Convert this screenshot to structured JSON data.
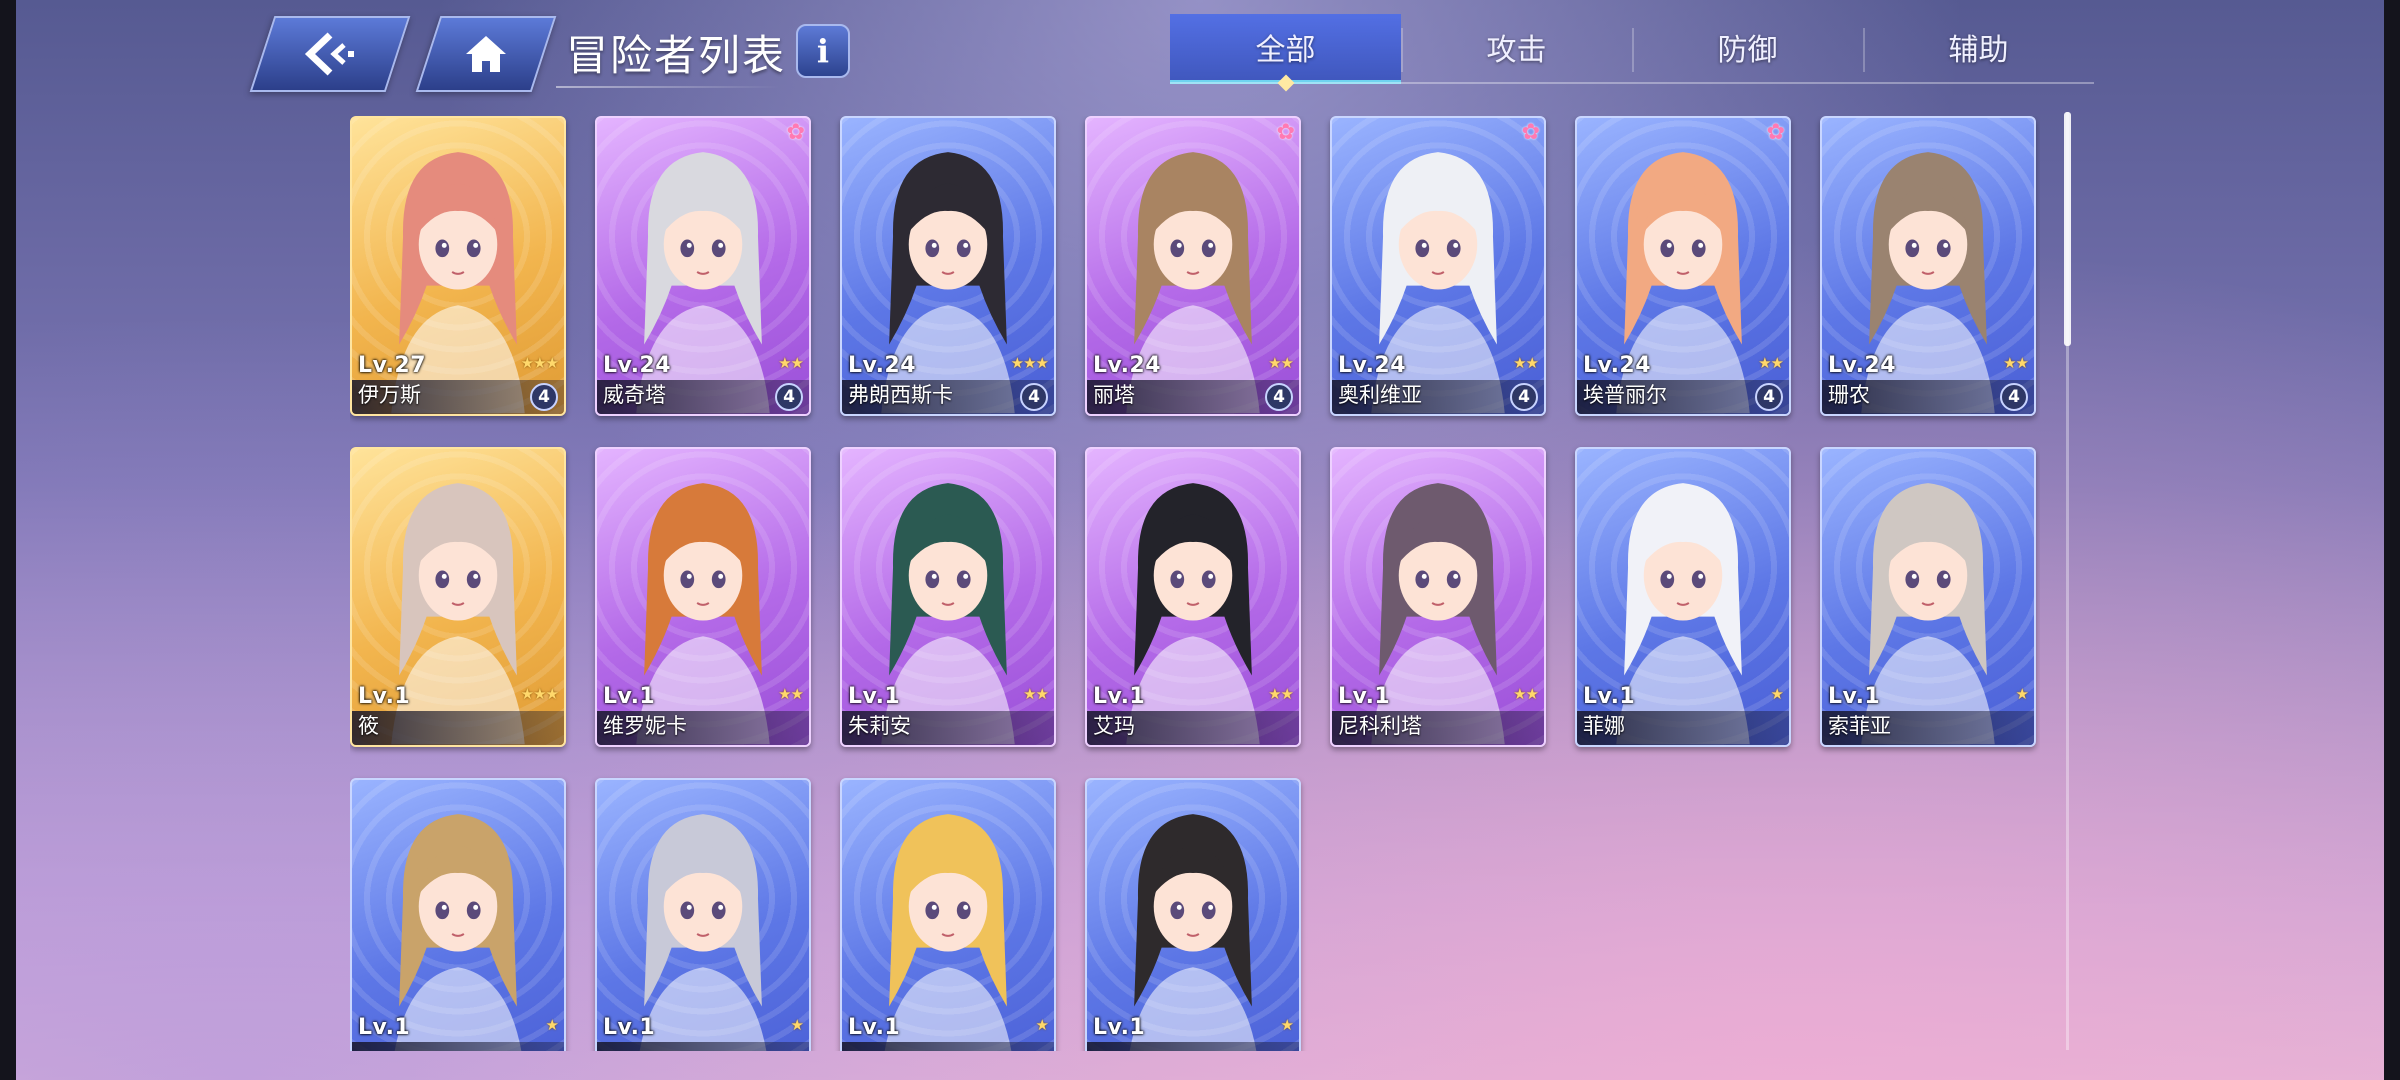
{
  "header": {
    "title": "冒险者列表",
    "info_label": "i",
    "tabs": [
      {
        "label": "全部",
        "active": true
      },
      {
        "label": "攻击",
        "active": false
      },
      {
        "label": "防御",
        "active": false
      },
      {
        "label": "辅助",
        "active": false
      }
    ]
  },
  "colors": {
    "gold_frame": "#f2b54e",
    "purple_frame": "#b46ae8",
    "blue_frame": "#5d77e6",
    "tab_active": "#506ee6",
    "star": "#ffd86b"
  },
  "adventurers": [
    {
      "level": "Lv.27",
      "name": "伊万斯",
      "stars": "★★★",
      "badge": "4",
      "paw": false,
      "frame": "gold",
      "hair": "#e58b7d"
    },
    {
      "level": "Lv.24",
      "name": "威奇塔",
      "stars": "★★",
      "badge": "4",
      "paw": true,
      "frame": "purple",
      "hair": "#d9d9df"
    },
    {
      "level": "Lv.24",
      "name": "弗朗西斯卡",
      "stars": "★★★",
      "badge": "4",
      "paw": false,
      "frame": "blue",
      "hair": "#2d2a33"
    },
    {
      "level": "Lv.24",
      "name": "丽塔",
      "stars": "★★",
      "badge": "4",
      "paw": true,
      "frame": "purple",
      "hair": "#a98462"
    },
    {
      "level": "Lv.24",
      "name": "奥利维亚",
      "stars": "★★",
      "badge": "4",
      "paw": true,
      "frame": "blue",
      "hair": "#eef0f5"
    },
    {
      "level": "Lv.24",
      "name": "埃普丽尔",
      "stars": "★★",
      "badge": "4",
      "paw": true,
      "frame": "blue",
      "hair": "#f2a982"
    },
    {
      "level": "Lv.24",
      "name": "珊农",
      "stars": "★★",
      "badge": "4",
      "paw": false,
      "frame": "blue",
      "hair": "#9a8370"
    },
    {
      "level": "Lv.1",
      "name": "筱",
      "stars": "★★★",
      "badge": "",
      "paw": false,
      "frame": "gold",
      "hair": "#d8c5bd"
    },
    {
      "level": "Lv.1",
      "name": "维罗妮卡",
      "stars": "★★",
      "badge": "",
      "paw": false,
      "frame": "purple",
      "hair": "#d77a3a"
    },
    {
      "level": "Lv.1",
      "name": "朱莉安",
      "stars": "★★",
      "badge": "",
      "paw": false,
      "frame": "purple",
      "hair": "#2b5a52"
    },
    {
      "level": "Lv.1",
      "name": "艾玛",
      "stars": "★★",
      "badge": "",
      "paw": false,
      "frame": "purple",
      "hair": "#23232a"
    },
    {
      "level": "Lv.1",
      "name": "尼科利塔",
      "stars": "★★",
      "badge": "",
      "paw": false,
      "frame": "purple",
      "hair": "#6e5a6e"
    },
    {
      "level": "Lv.1",
      "name": "菲娜",
      "stars": "★",
      "badge": "",
      "paw": false,
      "frame": "blue",
      "hair": "#f1f2f8"
    },
    {
      "level": "Lv.1",
      "name": "索菲亚",
      "stars": "★",
      "badge": "",
      "paw": false,
      "frame": "blue",
      "hair": "#cfc7c2"
    },
    {
      "level": "Lv.1",
      "name": "",
      "stars": "★",
      "badge": "",
      "paw": false,
      "frame": "blue",
      "hair": "#c9a36a"
    },
    {
      "level": "Lv.1",
      "name": "",
      "stars": "★",
      "badge": "",
      "paw": false,
      "frame": "blue",
      "hair": "#c8c9d8"
    },
    {
      "level": "Lv.1",
      "name": "",
      "stars": "★",
      "badge": "",
      "paw": false,
      "frame": "blue",
      "hair": "#f0c25a"
    },
    {
      "level": "Lv.1",
      "name": "",
      "stars": "★",
      "badge": "",
      "paw": false,
      "frame": "blue",
      "hair": "#2e2a2c"
    }
  ]
}
